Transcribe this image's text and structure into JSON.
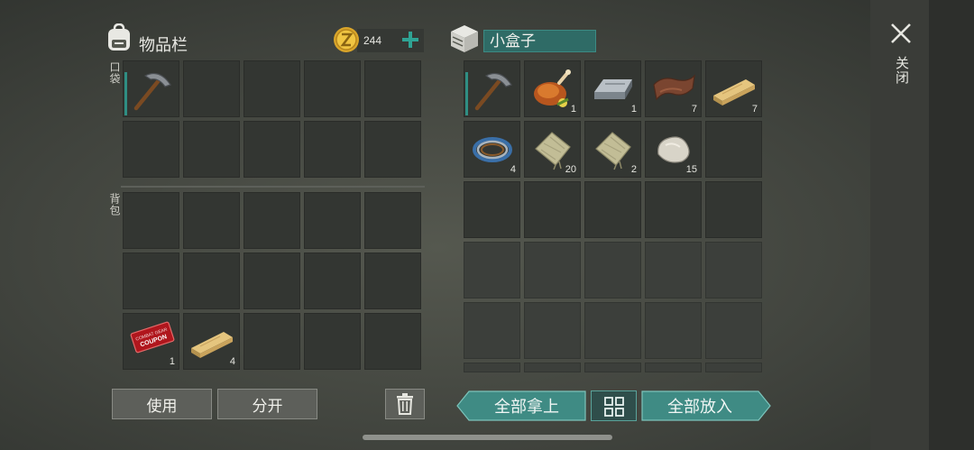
{
  "inventory": {
    "title": "物品栏",
    "coins": "244",
    "pocket_label": "口袋",
    "backpack_label": "背包",
    "pocket_slots": [
      {
        "item": "pickaxe-icon",
        "count": "",
        "selected": true
      },
      {},
      {},
      {},
      {},
      {},
      {},
      {},
      {},
      {}
    ],
    "backpack_slots": [
      {},
      {},
      {},
      {},
      {},
      {},
      {},
      {},
      {},
      {},
      {
        "item": "coupon-icon",
        "count": "1"
      },
      {
        "item": "plank-icon",
        "count": "4"
      },
      {},
      {},
      {}
    ],
    "coupon_text": "COMBAT GEAR COUPON",
    "use_button": "使用",
    "split_button": "分开"
  },
  "container": {
    "name": "小盒子",
    "slots": [
      {
        "item": "pickaxe-icon",
        "count": "",
        "selected": true
      },
      {
        "item": "roast-chicken-icon",
        "count": "1"
      },
      {
        "item": "iron-bar-icon",
        "count": "1"
      },
      {
        "item": "leather-icon",
        "count": "7"
      },
      {
        "item": "plank-icon",
        "count": "7"
      },
      {
        "item": "wire-coil-icon",
        "count": "4"
      },
      {
        "item": "cloth-icon",
        "count": "20"
      },
      {
        "item": "cloth-icon",
        "count": "2"
      },
      {
        "item": "stone-icon",
        "count": "15"
      },
      {}
    ],
    "take_all_button": "全部拿上",
    "put_all_button": "全部放入"
  },
  "close_label": "关闭",
  "colors": {
    "accent": "#2f8e83",
    "teal_button": "#3f8b84"
  }
}
